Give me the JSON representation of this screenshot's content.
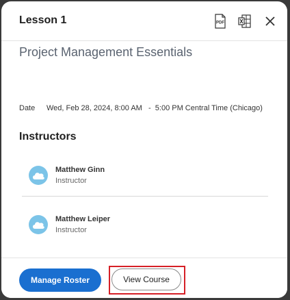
{
  "dialog": {
    "lesson_title": "Lesson 1",
    "icons": {
      "pdf": "pdf-icon",
      "excel": "excel-export-icon",
      "close": "close-icon"
    },
    "pdf_icon_text": "PDF",
    "course_title": "Project Management Essentials",
    "date": {
      "label": "Date",
      "value": "Wed, Feb 28, 2024, 8:00 AM   -  5:00 PM Central Time (Chicago)"
    },
    "instructors_heading": "Instructors",
    "instructors": [
      {
        "name": "Matthew Ginn",
        "role": "Instructor"
      },
      {
        "name": "Matthew Leiper",
        "role": "Instructor"
      }
    ]
  },
  "footer": {
    "manage_roster_label": "Manage Roster",
    "view_course_label": "View Course"
  },
  "colors": {
    "primary": "#1a6fd0",
    "highlight": "#d61f26",
    "avatar": "#7cc4e8"
  }
}
